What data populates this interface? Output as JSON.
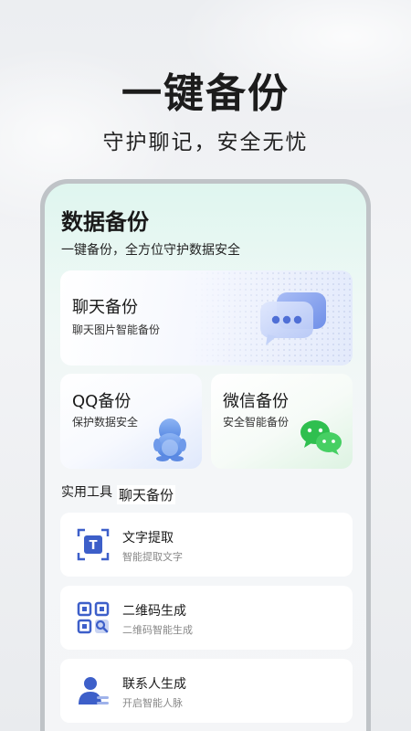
{
  "hero": {
    "title": "一键备份",
    "subtitle": "守护聊记，安全无忧"
  },
  "screen": {
    "title": "数据备份",
    "subtitle": "一键备份，全方位守护数据安全"
  },
  "cards": {
    "chat": {
      "title": "聊天备份",
      "desc": "聊天图片智能备份",
      "icon": "chat-bubbles-icon"
    },
    "qq": {
      "title": "QQ备份",
      "desc": "保护数据安全",
      "icon": "qq-penguin-icon"
    },
    "wechat": {
      "title": "微信备份",
      "desc": "安全智能备份",
      "icon": "wechat-icon"
    }
  },
  "tools_section": {
    "label": "实用工具",
    "overlay_label": "聊天备份"
  },
  "tools": [
    {
      "name": "文字提取",
      "desc": "智能提取文字",
      "icon": "text-scan-icon"
    },
    {
      "name": "二维码生成",
      "desc": "二维码智能生成",
      "icon": "qr-code-icon"
    },
    {
      "name": "联系人生成",
      "desc": "开启智能人脉",
      "icon": "contact-icon"
    }
  ],
  "colors": {
    "accent_blue": "#3d5fc9",
    "wechat_green": "#2fbf4f",
    "qq_blue": "#5b8fe6"
  }
}
